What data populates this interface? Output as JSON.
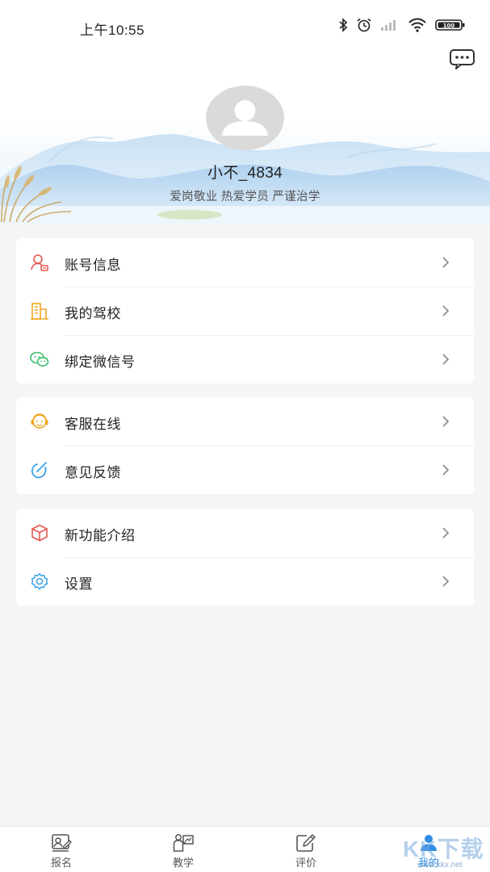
{
  "status_bar": {
    "time": "上午10:55",
    "battery": "100"
  },
  "header": {
    "message_icon": "chat-bubble-icon",
    "avatar_icon": "default-avatar-icon",
    "username": "小不_4834",
    "motto": "爱岗敬业 热爱学员 严谨治学"
  },
  "menu_groups": [
    {
      "items": [
        {
          "label": "账号信息",
          "icon": "account-icon",
          "color": "#e8564f"
        },
        {
          "label": "我的驾校",
          "icon": "building-icon",
          "color": "#f0a620"
        },
        {
          "label": "绑定微信号",
          "icon": "wechat-icon",
          "color": "#3cbf6a"
        }
      ]
    },
    {
      "items": [
        {
          "label": "客服在线",
          "icon": "headset-icon",
          "color": "#f0a620"
        },
        {
          "label": "意见反馈",
          "icon": "feedback-icon",
          "color": "#3ba3e8"
        }
      ]
    },
    {
      "items": [
        {
          "label": "新功能介绍",
          "icon": "box-icon",
          "color": "#e8564f"
        },
        {
          "label": "设置",
          "icon": "gear-icon",
          "color": "#3ba3e8"
        }
      ]
    }
  ],
  "tabbar": {
    "tabs": [
      {
        "label": "报名",
        "icon": "signup-icon"
      },
      {
        "label": "教学",
        "icon": "teaching-icon"
      },
      {
        "label": "评价",
        "icon": "evaluate-icon"
      },
      {
        "label": "我的",
        "icon": "profile-icon",
        "active": true
      }
    ],
    "active_color": "#2f8de4"
  },
  "watermark": {
    "text": "KK下载",
    "url": "www.kkx.net"
  }
}
